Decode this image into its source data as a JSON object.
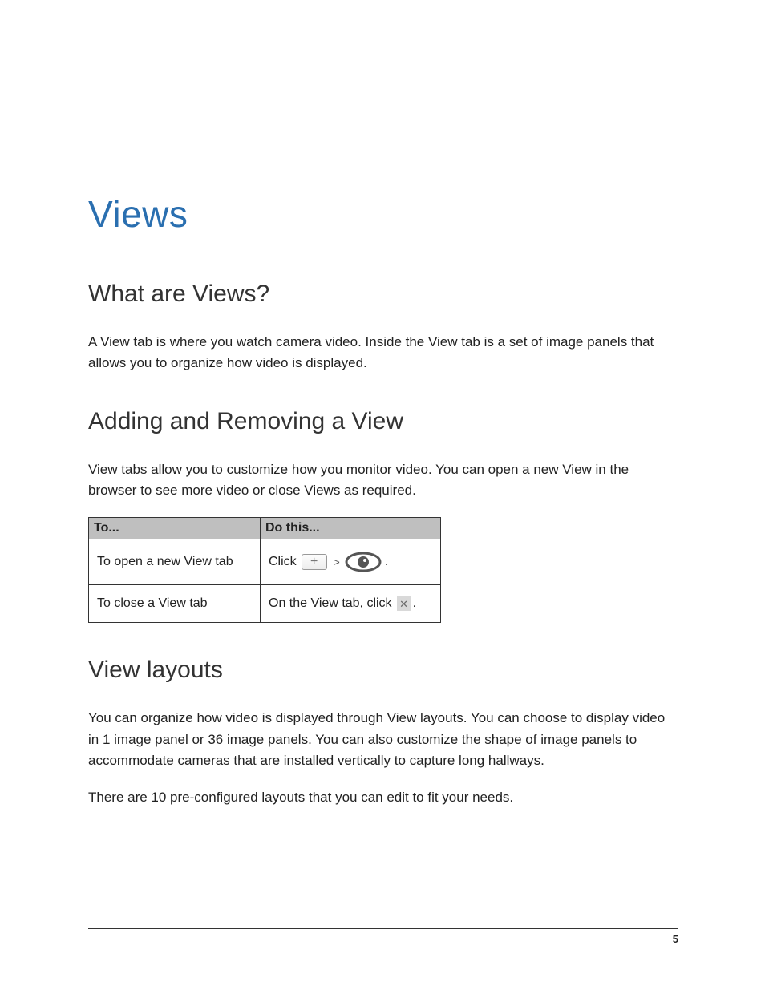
{
  "title": "Views",
  "sections": {
    "what": {
      "heading": "What are Views?",
      "body": "A View tab is where you watch camera video. Inside the View tab is a set of image panels that allows you to organize how video is displayed."
    },
    "adding": {
      "heading": "Adding and Removing a View",
      "body": "View tabs allow you to customize how you monitor video. You can open a new View in the browser to see more video or close Views as required.",
      "table": {
        "headers": {
          "to": "To...",
          "do": "Do this..."
        },
        "rows": [
          {
            "to": "To open a new View tab",
            "do_prefix": "Click",
            "plus_glyph": "+",
            "separator": ">",
            "do_suffix": "."
          },
          {
            "to": "To close a View tab",
            "do_prefix": "On the View tab, click",
            "close_glyph": "✕",
            "do_suffix": "."
          }
        ]
      }
    },
    "layouts": {
      "heading": "View layouts",
      "body1": "You can organize how video is displayed through View layouts. You can choose to display video in 1 image panel or 36 image panels. You can also customize the shape of image panels to accommodate cameras that are installed vertically to capture long hallways.",
      "body2": "There are 10 pre-configured layouts that you can edit to fit your needs."
    }
  },
  "page_number": "5"
}
